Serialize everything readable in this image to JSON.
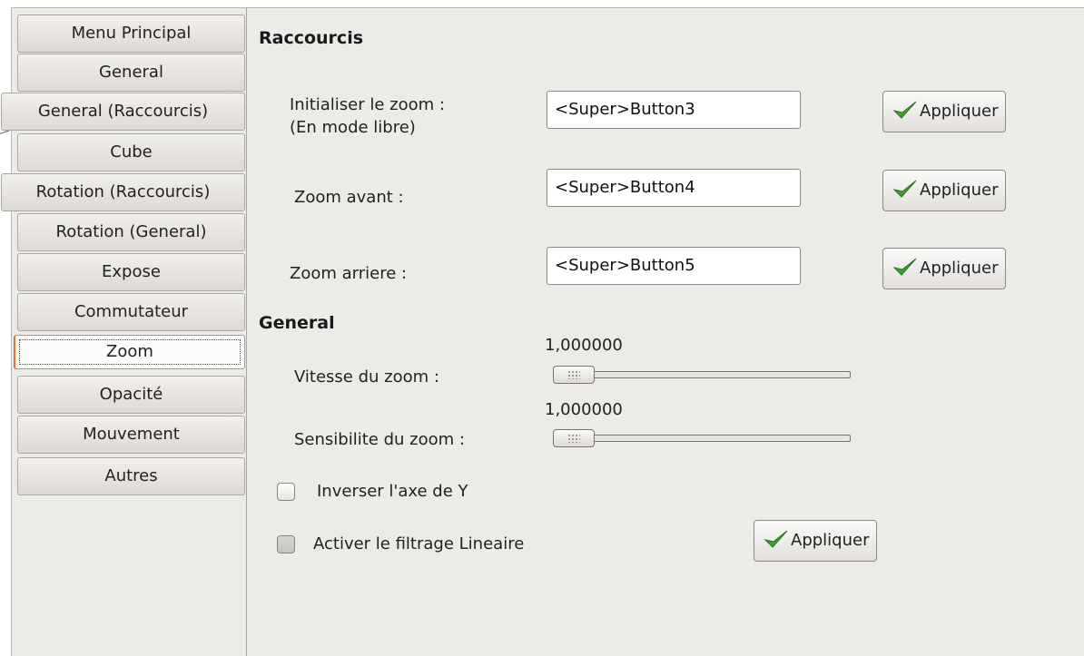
{
  "sidebar": {
    "items": [
      {
        "label": "Menu Principal"
      },
      {
        "label": "General"
      },
      {
        "label": "General (Raccourcis)"
      },
      {
        "label": "Cube"
      },
      {
        "label": "Rotation (Raccourcis)"
      },
      {
        "label": "Rotation (General)"
      },
      {
        "label": "Expose"
      },
      {
        "label": "Commutateur"
      },
      {
        "label": "Zoom"
      },
      {
        "label": "Opacité"
      },
      {
        "label": "Mouvement"
      },
      {
        "label": "Autres"
      }
    ],
    "active": "Zoom"
  },
  "shortcuts": {
    "heading": "Raccourcis",
    "rows": [
      {
        "label_line1": "Initialiser le zoom :",
        "label_line2": "(En mode libre)",
        "value": "<Super>Button3",
        "button": "Appliquer"
      },
      {
        "label_line1": "Zoom avant :",
        "value": "<Super>Button4",
        "button": "Appliquer"
      },
      {
        "label_line1": "Zoom arriere :",
        "value": "<Super>Button5",
        "button": "Appliquer"
      }
    ]
  },
  "general": {
    "heading": "General",
    "speed": {
      "label": "Vitesse du zoom :",
      "value": "1,000000",
      "fraction": 0.0
    },
    "sensitivity": {
      "label": "Sensibilite du zoom :",
      "value": "1,000000",
      "fraction": 0.0
    },
    "invert_y": {
      "label": "Inverser l'axe de Y",
      "checked": false
    },
    "linear_filter": {
      "label": "Activer le filtrage Lineaire",
      "checked": false
    },
    "apply_button": "Appliquer"
  },
  "icons": {
    "apply": "checkmark-icon",
    "check_color": "#3aa52a"
  }
}
